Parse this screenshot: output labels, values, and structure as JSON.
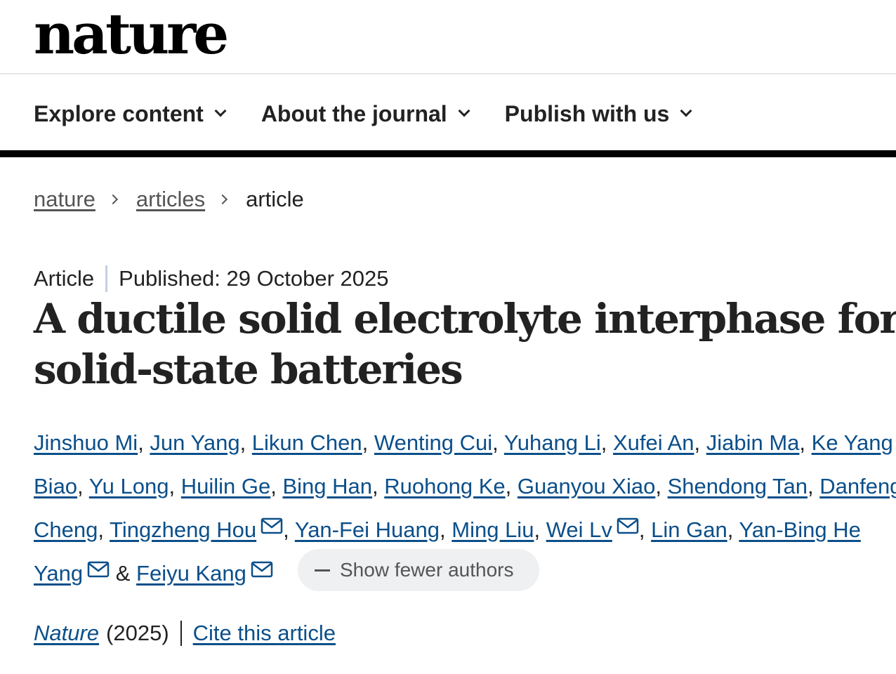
{
  "brand": {
    "logo": "nature"
  },
  "nav": {
    "items": [
      {
        "label": "Explore content",
        "icon": "chevron-down-icon"
      },
      {
        "label": "About the journal",
        "icon": "chevron-down-icon"
      },
      {
        "label": "Publish with us",
        "icon": "chevron-down-icon"
      }
    ]
  },
  "breadcrumb": {
    "items": [
      "nature",
      "articles"
    ],
    "current": "article",
    "separator_icon": "chevron-right-icon"
  },
  "article": {
    "type": "Article",
    "published": "Published: 29 October 2025",
    "title": "A ductile solid electrolyte interphase for solid-state batteries"
  },
  "authors": {
    "list": [
      "Jinshuo Mi",
      "Jun Yang",
      "Likun Chen",
      "Wenting Cui",
      "Yuhang Li",
      "Xufei An",
      "Jiabin Ma",
      "Ke Yang",
      "Biao",
      "Yu Long",
      "Huilin Ge",
      "Bing Han",
      "Ruohong Ke",
      "Guanyou Xiao",
      "Shendong Tan",
      "Danfeng",
      "Cheng",
      "Tingzheng Hou",
      "Yan-Fei Huang",
      "Ming Liu",
      "Wei Lv",
      "Lin Gan",
      "Yan-Bing He",
      "Yang",
      "Feiyu Kang"
    ],
    "ampersand": "&",
    "contact_icon": "mail-icon",
    "show_fewer_label": "Show fewer authors"
  },
  "citation": {
    "journal": "Nature",
    "year": "(2025)",
    "cite_label": "Cite this article"
  },
  "colors": {
    "link": "#0b4f8a",
    "text": "#222222",
    "pill_bg": "#eef0f2",
    "divider": "#c5cfe0"
  }
}
